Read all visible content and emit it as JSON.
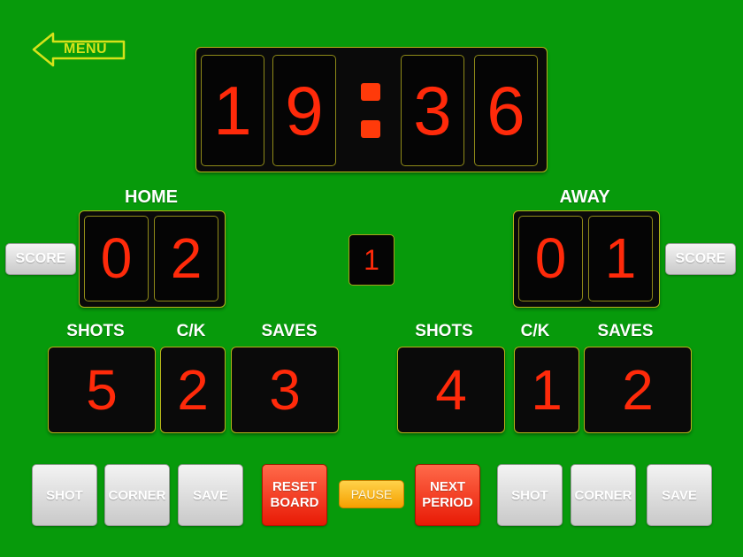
{
  "menu": {
    "label": "MENU",
    "icon": "arrow-left-icon",
    "color": "#d6e21a"
  },
  "clock": {
    "digits": [
      "1",
      "9",
      "3",
      "6"
    ]
  },
  "period": "1",
  "home": {
    "label": "HOME",
    "score_digits": [
      "0",
      "2"
    ],
    "score_button": "SCORE",
    "stats": {
      "shots_label": "SHOTS",
      "shots": "5",
      "ck_label": "C/K",
      "ck": "2",
      "saves_label": "SAVES",
      "saves": "3"
    },
    "buttons": {
      "shot": "SHOT",
      "corner": "CORNER",
      "save": "SAVE"
    }
  },
  "away": {
    "label": "AWAY",
    "score_digits": [
      "0",
      "1"
    ],
    "score_button": "SCORE",
    "stats": {
      "shots_label": "SHOTS",
      "shots": "4",
      "ck_label": "C/K",
      "ck": "1",
      "saves_label": "SAVES",
      "saves": "2"
    },
    "buttons": {
      "shot": "SHOT",
      "corner": "CORNER",
      "save": "SAVE"
    }
  },
  "controls": {
    "reset_line1": "RESET",
    "reset_line2": "BOARD",
    "pause": "PAUSE",
    "next_line1": "NEXT",
    "next_line2": "PERIOD"
  },
  "colors": {
    "background": "#079a0b",
    "digit": "#ff2a0a",
    "panel_border": "#b8b21a",
    "reset_button": "#e81a06",
    "pause_button": "#f5a000"
  }
}
